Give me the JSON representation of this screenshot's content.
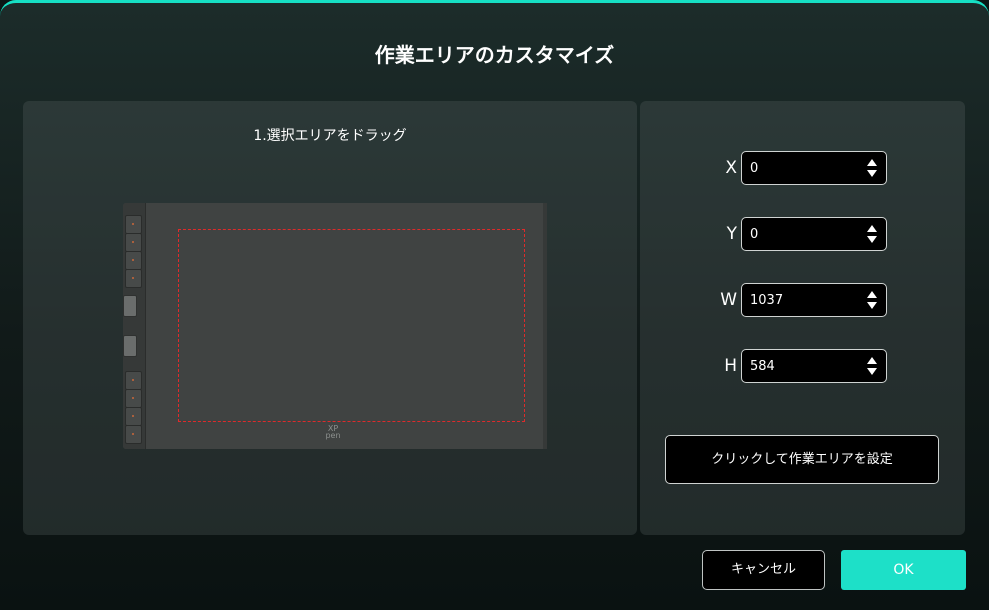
{
  "dialog": {
    "title": "作業エリアのカスタマイズ",
    "accent_color": "#1de0c8"
  },
  "preview": {
    "instruction": "1.選択エリアをドラッグ",
    "tablet_logo": "XP pen",
    "work_area_border_color": "#e02a2a"
  },
  "fields": [
    {
      "label": "X",
      "value": "0"
    },
    {
      "label": "Y",
      "value": "0"
    },
    {
      "label": "W",
      "value": "1037"
    },
    {
      "label": "H",
      "value": "584"
    }
  ],
  "set_button_label": "クリックして作業エリアを設定",
  "footer": {
    "cancel_label": "キャンセル",
    "ok_label": "OK"
  }
}
